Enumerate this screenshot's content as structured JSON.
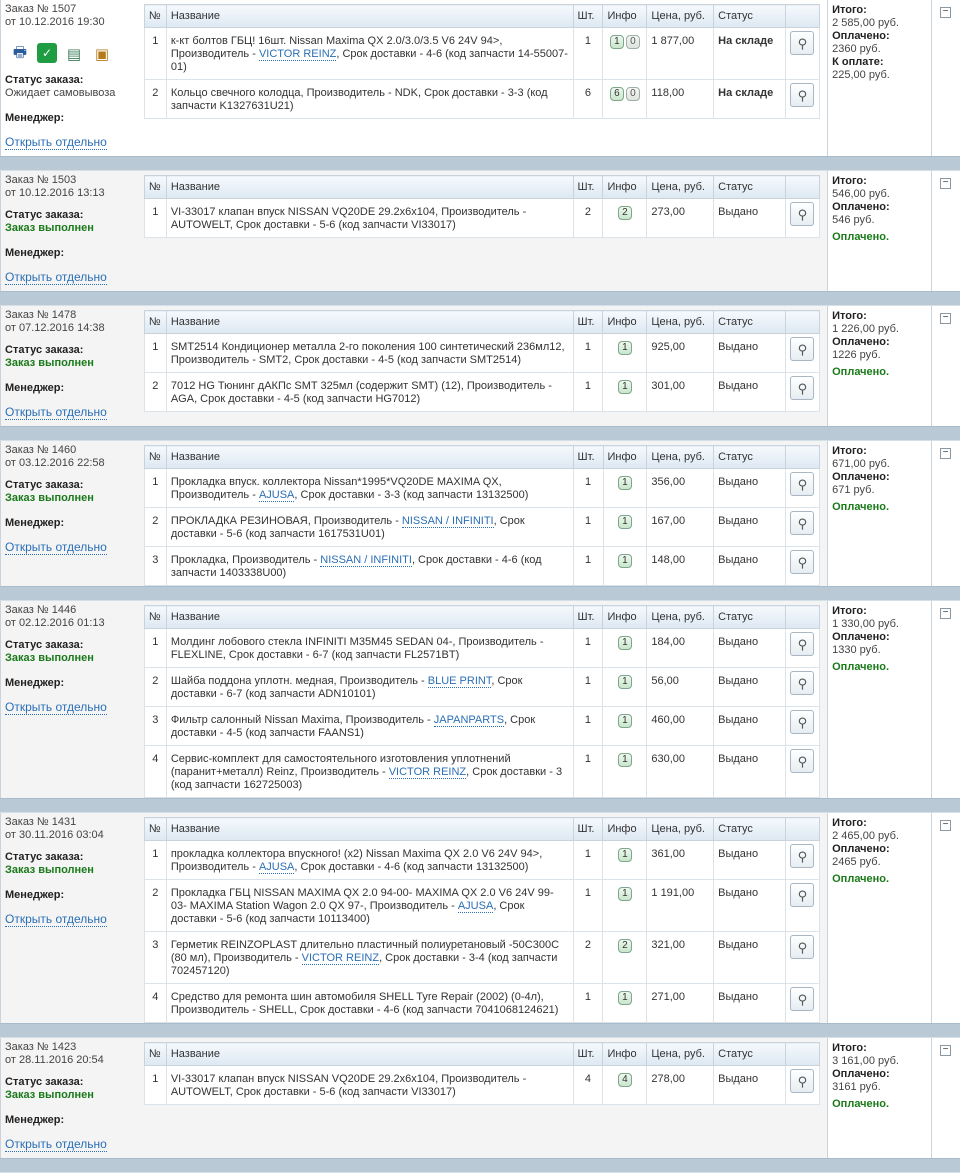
{
  "headers": {
    "num": "№",
    "name": "Название",
    "qty": "Шт.",
    "info": "Инфо",
    "price": "Цена, руб.",
    "status": "Статус"
  },
  "labels": {
    "status_label": "Статус заказа:",
    "manager_label": "Менеджер:",
    "open_link": "Открыть отдельно",
    "total_label": "Итого:",
    "paid_label": "Оплачено:",
    "to_pay_label": "К оплате:",
    "paid_done": "Оплачено."
  },
  "icons": [
    "printer-icon",
    "sberbank-icon",
    "bank-transfer-icon",
    "package-icon"
  ],
  "orders": [
    {
      "title": "Заказ № 1507",
      "date": "от 10.12.2016 19:30",
      "status": "Ожидает самовывоза",
      "status_done": false,
      "show_icons": true,
      "total": "2 585,00 руб.",
      "paid": "2360 руб.",
      "to_pay": "225,00 руб.",
      "paid_done": false,
      "items": [
        {
          "n": "1",
          "segments": [
            {
              "t": "к-кт болтов ГБЦ! 16шт. Nissan Maxima QX 2.0/3.0/3.5 V6 24V 94>, Производитель - "
            },
            {
              "t": "VICTOR REINZ",
              "link": true
            },
            {
              "t": ", Срок доставки - 4-6 (код запчасти 14-55007-01)"
            }
          ],
          "qty": "1",
          "info": [
            "1",
            "0"
          ],
          "price": "1 877,00",
          "status": "На складе",
          "stock": true
        },
        {
          "n": "2",
          "segments": [
            {
              "t": "Кольцо свечного колодца, Производитель - NDK, Срок доставки - 3-3 (код запчасти K1327631U21)"
            }
          ],
          "qty": "6",
          "info": [
            "6",
            "0"
          ],
          "price": "118,00",
          "status": "На складе",
          "stock": true
        }
      ]
    },
    {
      "title": "Заказ № 1503",
      "date": "от 10.12.2016 13:13",
      "status": "Заказ выполнен",
      "status_done": true,
      "show_icons": false,
      "total": "546,00 руб.",
      "paid": "546 руб.",
      "to_pay": null,
      "paid_done": true,
      "items": [
        {
          "n": "1",
          "segments": [
            {
              "t": "VI-33017 клапан впуск NISSAN VQ20DE 29.2x6x104, Производитель - AUTOWELT, Срок доставки - 5-6 (код запчасти VI33017)"
            }
          ],
          "qty": "2",
          "info": [
            "2"
          ],
          "price": "273,00",
          "status": "Выдано",
          "stock": false
        }
      ]
    },
    {
      "title": "Заказ № 1478",
      "date": "от 07.12.2016 14:38",
      "status": "Заказ выполнен",
      "status_done": true,
      "show_icons": false,
      "total": "1 226,00 руб.",
      "paid": "1226 руб.",
      "to_pay": null,
      "paid_done": true,
      "items": [
        {
          "n": "1",
          "segments": [
            {
              "t": "SMT2514 Кондиционер металла 2-го поколения 100 синтетический 236мл12, Производитель - SMT2, Срок доставки - 4-5 (код запчасти SMT2514)"
            }
          ],
          "qty": "1",
          "info": [
            "1"
          ],
          "price": "925,00",
          "status": "Выдано",
          "stock": false
        },
        {
          "n": "2",
          "segments": [
            {
              "t": "7012 HG Тюнинг дАКПс SMT 325мл (содержит SMT) (12), Производитель - AGA, Срок доставки - 4-5 (код запчасти HG7012)"
            }
          ],
          "qty": "1",
          "info": [
            "1"
          ],
          "price": "301,00",
          "status": "Выдано",
          "stock": false
        }
      ]
    },
    {
      "title": "Заказ № 1460",
      "date": "от 03.12.2016 22:58",
      "status": "Заказ выполнен",
      "status_done": true,
      "show_icons": false,
      "total": "671,00 руб.",
      "paid": "671 руб.",
      "to_pay": null,
      "paid_done": true,
      "items": [
        {
          "n": "1",
          "segments": [
            {
              "t": "Прокладка впуск. коллектора Nissan*1995*VQ20DE MAXIMA QX, Производитель - "
            },
            {
              "t": "AJUSA",
              "link": true
            },
            {
              "t": ", Срок доставки - 3-3 (код запчасти 13132500)"
            }
          ],
          "qty": "1",
          "info": [
            "1"
          ],
          "price": "356,00",
          "status": "Выдано",
          "stock": false
        },
        {
          "n": "2",
          "segments": [
            {
              "t": "ПРОКЛАДКА РЕЗИНОВАЯ, Производитель - "
            },
            {
              "t": "NISSAN / INFINITI",
              "link": true
            },
            {
              "t": ", Срок доставки - 5-6 (код запчасти 1617531U01)"
            }
          ],
          "qty": "1",
          "info": [
            "1"
          ],
          "price": "167,00",
          "status": "Выдано",
          "stock": false
        },
        {
          "n": "3",
          "segments": [
            {
              "t": "Прокладка, Производитель - "
            },
            {
              "t": "NISSAN / INFINITI",
              "link": true
            },
            {
              "t": ", Срок доставки - 4-6 (код запчасти 1403338U00)"
            }
          ],
          "qty": "1",
          "info": [
            "1"
          ],
          "price": "148,00",
          "status": "Выдано",
          "stock": false
        }
      ]
    },
    {
      "title": "Заказ № 1446",
      "date": "от 02.12.2016 01:13",
      "status": "Заказ выполнен",
      "status_done": true,
      "show_icons": false,
      "total": "1 330,00 руб.",
      "paid": "1330 руб.",
      "to_pay": null,
      "paid_done": true,
      "items": [
        {
          "n": "1",
          "segments": [
            {
              "t": "Молдинг лобового стекла INFINITI M35M45 SEDAN 04-, Производитель - FLEXLINE, Срок доставки - 6-7 (код запчасти FL2571BT)"
            }
          ],
          "qty": "1",
          "info": [
            "1"
          ],
          "price": "184,00",
          "status": "Выдано",
          "stock": false
        },
        {
          "n": "2",
          "segments": [
            {
              "t": "Шайба поддона уплотн. медная, Производитель - "
            },
            {
              "t": "BLUE PRINT",
              "link": true
            },
            {
              "t": ", Срок доставки - 6-7 (код запчасти ADN10101)"
            }
          ],
          "qty": "1",
          "info": [
            "1"
          ],
          "price": "56,00",
          "status": "Выдано",
          "stock": false
        },
        {
          "n": "3",
          "segments": [
            {
              "t": "Фильтр салонный Nissan Maxima, Производитель - "
            },
            {
              "t": "JAPANPARTS",
              "link": true
            },
            {
              "t": ", Срок доставки - 4-5 (код запчасти FAANS1)"
            }
          ],
          "qty": "1",
          "info": [
            "1"
          ],
          "price": "460,00",
          "status": "Выдано",
          "stock": false
        },
        {
          "n": "4",
          "segments": [
            {
              "t": "Сервис-комплект для самостоятельного изготовления уплотнений (паранит+металл) Reinz, Производитель - "
            },
            {
              "t": "VICTOR REINZ",
              "link": true
            },
            {
              "t": ", Срок доставки - 3 (код запчасти 162725003)"
            }
          ],
          "qty": "1",
          "info": [
            "1"
          ],
          "price": "630,00",
          "status": "Выдано",
          "stock": false
        }
      ]
    },
    {
      "title": "Заказ № 1431",
      "date": "от 30.11.2016 03:04",
      "status": "Заказ выполнен",
      "status_done": true,
      "show_icons": false,
      "total": "2 465,00 руб.",
      "paid": "2465 руб.",
      "to_pay": null,
      "paid_done": true,
      "items": [
        {
          "n": "1",
          "segments": [
            {
              "t": "прокладка коллектора впускного! (x2) Nissan Maxima QX 2.0 V6 24V 94>, Производитель - "
            },
            {
              "t": "AJUSA",
              "link": true
            },
            {
              "t": ", Срок доставки - 4-6 (код запчасти 13132500)"
            }
          ],
          "qty": "1",
          "info": [
            "1"
          ],
          "price": "361,00",
          "status": "Выдано",
          "stock": false
        },
        {
          "n": "2",
          "segments": [
            {
              "t": "Прокладка ГБЦ NISSAN MAXIMA QX 2.0 94-00- MAXIMA QX 2.0 V6 24V 99-03- MAXIMA Station Wagon 2.0 QX 97-, Производитель - "
            },
            {
              "t": "AJUSA",
              "link": true
            },
            {
              "t": ", Срок доставки - 5-6 (код запчасти 10113400)"
            }
          ],
          "qty": "1",
          "info": [
            "1"
          ],
          "price": "1 191,00",
          "status": "Выдано",
          "stock": false
        },
        {
          "n": "3",
          "segments": [
            {
              "t": "Герметик REINZOPLAST длительно пластичный полиуретановый -50С300С (80 мл), Производитель - "
            },
            {
              "t": "VICTOR REINZ",
              "link": true
            },
            {
              "t": ", Срок доставки - 3-4 (код запчасти 702457120)"
            }
          ],
          "qty": "2",
          "info": [
            "2"
          ],
          "price": "321,00",
          "status": "Выдано",
          "stock": false
        },
        {
          "n": "4",
          "segments": [
            {
              "t": "Средство для ремонта шин автомобиля SHELL Tyre Repair (2002) (0-4л), Производитель - SHELL, Срок доставки - 4-6 (код запчасти 7041068124621)"
            }
          ],
          "qty": "1",
          "info": [
            "1"
          ],
          "price": "271,00",
          "status": "Выдано",
          "stock": false
        }
      ]
    },
    {
      "title": "Заказ № 1423",
      "date": "от 28.11.2016 20:54",
      "status": "Заказ выполнен",
      "status_done": true,
      "show_icons": false,
      "total": "3 161,00 руб.",
      "paid": "3161 руб.",
      "to_pay": null,
      "paid_done": true,
      "items": [
        {
          "n": "1",
          "segments": [
            {
              "t": "VI-33017 клапан впуск NISSAN VQ20DE 29.2x6x104, Производитель - AUTOWELT, Срок доставки - 5-6 (код запчасти VI33017)"
            }
          ],
          "qty": "4",
          "info": [
            "4"
          ],
          "price": "278,00",
          "status": "Выдано",
          "stock": false
        }
      ]
    }
  ]
}
